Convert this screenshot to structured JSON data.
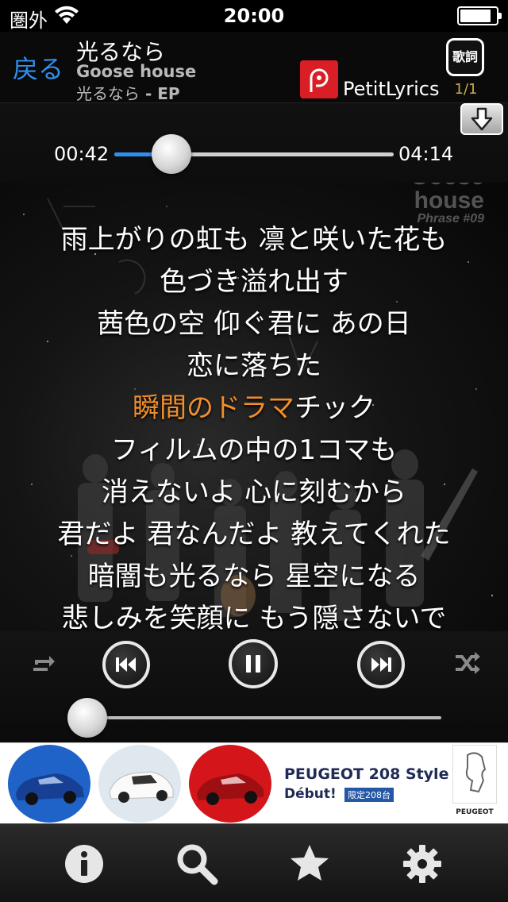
{
  "status_bar": {
    "carrier": "圏外",
    "time": "20:00"
  },
  "header": {
    "back_label": "戻る",
    "song_title": "光るなら",
    "artist": "Goose house",
    "album_name": "光るなら",
    "album_suffix": " - EP",
    "provider_name": "PetitLyrics",
    "lyrics_button_label": "歌詞",
    "page_indicator": "1/1"
  },
  "playback": {
    "elapsed": "00:42",
    "total": "04:14",
    "progress_fraction": 0.17,
    "volume_fraction": 0.0
  },
  "watermark": {
    "line1": "Goose",
    "line2": "house",
    "line3": "Phrase #09"
  },
  "lyrics": {
    "lines": [
      {
        "text": "雨上がりの虹も 凛と咲いた花も"
      },
      {
        "text": "色づき溢れ出す"
      },
      {
        "text": "茜色の空 仰ぐ君に あの日"
      },
      {
        "text": "恋に落ちた"
      },
      {
        "highlight": "瞬間のドラマ",
        "text": "チック"
      },
      {
        "text": "フィルムの中の1コマも"
      },
      {
        "text": "消えないよ 心に刻むから"
      },
      {
        "text": "君だよ 君なんだよ 教えてくれた"
      },
      {
        "text": "暗闇も光るなら 星空になる"
      },
      {
        "text": "悲しみを笑顔に もう隠さないで"
      }
    ]
  },
  "ad": {
    "title": "PEUGEOT 208 Style",
    "subtitle": "Début!",
    "tag": "限定208台",
    "logo_text": "PEUGEOT"
  },
  "colors": {
    "accent_blue": "#2f8ff0",
    "lyric_highlight": "#f28e2b",
    "page_indicator": "#c9a94e"
  },
  "icons": {
    "repeat": "repeat-icon",
    "previous": "skip-previous-icon",
    "pause": "pause-icon",
    "next": "skip-next-icon",
    "shuffle": "shuffle-icon",
    "download": "download-arrow-icon",
    "tabs": [
      "info-icon",
      "search-icon",
      "star-icon",
      "gear-icon"
    ]
  }
}
